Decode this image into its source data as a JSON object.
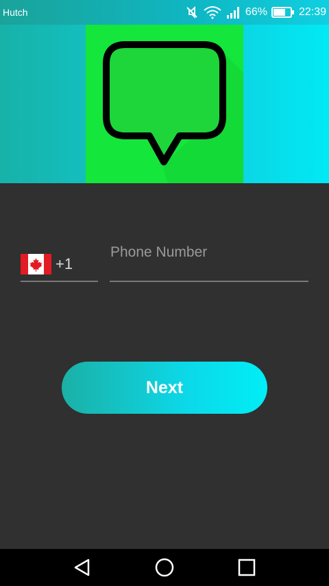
{
  "status_bar": {
    "carrier": "Hutch",
    "battery": "66%",
    "time": "22:39"
  },
  "form": {
    "country_code": "+1",
    "phone_placeholder": "Phone Number",
    "phone_value": "",
    "next_label": "Next"
  },
  "icons": {
    "flag": "canada-flag-icon",
    "hero": "chat-bubble-icon"
  },
  "colors": {
    "accent_start": "#1bb0a6",
    "accent_end": "#00eef6",
    "hero_tile": "#14e63b",
    "background": "#303030"
  }
}
